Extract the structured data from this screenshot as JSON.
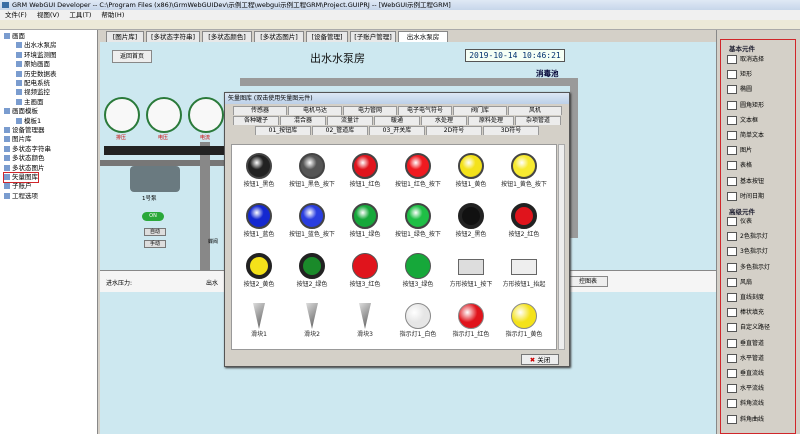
{
  "window": {
    "title": "GRM WebGUI Developer -- C:\\Program Files (x86)\\GrmWebGUIDev\\示例工程\\webgui示例工程GRM\\Project.GUIPRJ -- [WebGUI示例工程GRM]"
  },
  "menu": [
    "文件(F)",
    "视图(V)",
    "工具(T)",
    "帮助(H)"
  ],
  "tree": [
    {
      "label": "画面",
      "level": 0
    },
    {
      "label": "出水水泵房",
      "level": 2
    },
    {
      "label": "环境监测图",
      "level": 2
    },
    {
      "label": "原始画面",
      "level": 2
    },
    {
      "label": "历史数据表",
      "level": 2
    },
    {
      "label": "配电系统",
      "level": 2
    },
    {
      "label": "视频监控",
      "level": 2
    },
    {
      "label": "主画面",
      "level": 2
    },
    {
      "label": "画面模板",
      "level": 0
    },
    {
      "label": "模板1",
      "level": 2
    },
    {
      "label": "设备管理器",
      "level": 0
    },
    {
      "label": "图片库",
      "level": 0
    },
    {
      "label": "多状态字符串",
      "level": 0
    },
    {
      "label": "多状态颜色",
      "level": 0
    },
    {
      "label": "多状态图片",
      "level": 0
    },
    {
      "label": "矢量图库",
      "level": 0,
      "selected": true
    },
    {
      "label": "子账户",
      "level": 0
    },
    {
      "label": "工程选项",
      "level": 0
    }
  ],
  "tabs": [
    "[图片库]",
    "[多状态字符串]",
    "[多状态颜色]",
    "[多状态图片]",
    "[设备管理]",
    "[子账户管理]",
    "出水水泵房"
  ],
  "canvas": {
    "home_button": "返回首页",
    "page_title": "出水水泵房",
    "clock": "2019-10-14  10:46:21",
    "pool_label": "消毒池",
    "gauge_labels": [
      "排压",
      "电压",
      "电流"
    ],
    "pump_label": "1号泵",
    "on_label": "ON",
    "btn1": "自动",
    "btn2": "手动",
    "pressure_label": "进水压力:",
    "out_label": "出水",
    "right_btn": "控图表",
    "valve_label": "蝶阀"
  },
  "dialog": {
    "title": "矢量图库 (双击使用矢量图元件)",
    "tabs_row1": [
      "传感器",
      "电机马达",
      "电力管网",
      "电子电气符号",
      "阀门库",
      "风机"
    ],
    "tabs_row2": [
      "各种罐子",
      "混合器",
      "流量计",
      "暖通",
      "水处理",
      "原料处理",
      "杂项管道"
    ],
    "tabs_row3": [
      "01_按钮库",
      "02_管道库",
      "03_开关库",
      "2D符号",
      "3D符号"
    ],
    "items": [
      {
        "label": "按钮1_黑色",
        "kind": "btn",
        "color": "#222222"
      },
      {
        "label": "按钮1_黑色_按下",
        "kind": "btn",
        "color": "#555555"
      },
      {
        "label": "按钮1_红色",
        "kind": "btn",
        "color": "#e0141c"
      },
      {
        "label": "按钮1_红色_按下",
        "kind": "btn",
        "color": "#f01a20"
      },
      {
        "label": "按钮1_黄色",
        "kind": "btn",
        "color": "#f4e21a"
      },
      {
        "label": "按钮1_黄色_按下",
        "kind": "btn",
        "color": "#f7ea30"
      },
      {
        "label": "按钮1_蓝色",
        "kind": "btn",
        "color": "#1428d0"
      },
      {
        "label": "按钮1_蓝色_按下",
        "kind": "btn",
        "color": "#2a3ee0"
      },
      {
        "label": "按钮1_绿色",
        "kind": "btn",
        "color": "#16a83a"
      },
      {
        "label": "按钮1_绿色_按下",
        "kind": "btn",
        "color": "#1fbf46"
      },
      {
        "label": "按钮2_黑色",
        "kind": "ring",
        "color": "#111111"
      },
      {
        "label": "按钮2_红色",
        "kind": "ring",
        "color": "#e0141c"
      },
      {
        "label": "按钮2_黄色",
        "kind": "ring",
        "color": "#f4e21a"
      },
      {
        "label": "按钮2_绿色",
        "kind": "ring",
        "color": "#1a8a2a"
      },
      {
        "label": "按钮3_红色",
        "kind": "flat",
        "color": "#e0141c"
      },
      {
        "label": "按钮3_绿色",
        "kind": "flat",
        "color": "#16a83a"
      },
      {
        "label": "方形按钮1_按下",
        "kind": "square",
        "color": "#dddddd"
      },
      {
        "label": "方形按钮1_抬起",
        "kind": "square",
        "color": "#eeeeee"
      },
      {
        "label": "滑块1",
        "kind": "slider",
        "color": "#555555"
      },
      {
        "label": "滑块2",
        "kind": "slider",
        "color": "#555555"
      },
      {
        "label": "滑块3",
        "kind": "slider",
        "color": "#555555"
      },
      {
        "label": "指示灯1_白色",
        "kind": "lamp",
        "color": "#e6e6e6"
      },
      {
        "label": "指示灯1_红色",
        "kind": "lamp",
        "color": "#e0141c"
      },
      {
        "label": "指示灯1_黄色",
        "kind": "lamp",
        "color": "#f4e21a"
      }
    ],
    "close_label": "关闭"
  },
  "palette": {
    "section1": "基本元件",
    "basic": [
      {
        "label": "取消选择",
        "icon": "pointer-icon"
      },
      {
        "label": "矩形",
        "icon": "rectangle-icon"
      },
      {
        "label": "椭圆",
        "icon": "ellipse-icon"
      },
      {
        "label": "圆角矩形",
        "icon": "rounded-rect-icon"
      },
      {
        "label": "文本框",
        "icon": "textbox-icon"
      },
      {
        "label": "简单文本",
        "icon": "text-icon"
      },
      {
        "label": "图片",
        "icon": "image-icon"
      },
      {
        "label": "表格",
        "icon": "table-icon"
      },
      {
        "label": "基本按钮",
        "icon": "button-icon"
      },
      {
        "label": "时间日期",
        "icon": "datetime-icon"
      }
    ],
    "section2": "高级元件",
    "advanced": [
      {
        "label": "仪表",
        "icon": "gauge-icon"
      },
      {
        "label": "2色指示灯",
        "icon": "lamp2-icon"
      },
      {
        "label": "3色指示灯",
        "icon": "lamp3-icon"
      },
      {
        "label": "多色指示灯",
        "icon": "lamp-multi-icon"
      },
      {
        "label": "风扇",
        "icon": "fan-icon"
      },
      {
        "label": "直线刻度",
        "icon": "scale-icon"
      },
      {
        "label": "棒状填充",
        "icon": "bar-fill-icon"
      },
      {
        "label": "自定义路径",
        "icon": "path-icon"
      },
      {
        "label": "垂直管道",
        "icon": "vpipe-icon"
      },
      {
        "label": "水平管道",
        "icon": "hpipe-icon"
      },
      {
        "label": "垂直流线",
        "icon": "vflow-icon"
      },
      {
        "label": "水平流线",
        "icon": "hflow-icon"
      },
      {
        "label": "斜角流线",
        "icon": "diag-flow-icon"
      },
      {
        "label": "斜角曲线",
        "icon": "diag-curve-icon"
      }
    ]
  }
}
